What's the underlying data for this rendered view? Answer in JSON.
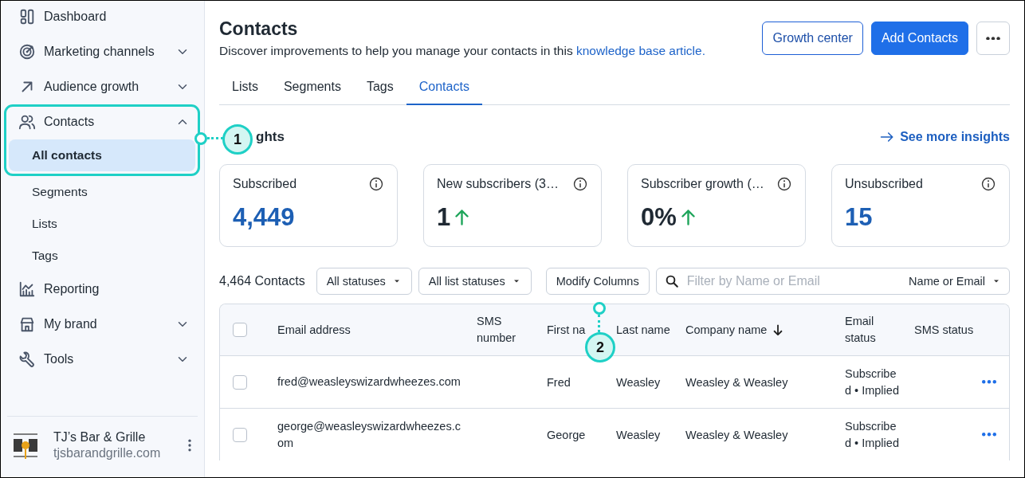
{
  "sidebar": {
    "items": [
      {
        "label": "Dashboard"
      },
      {
        "label": "Marketing channels",
        "expanded": false
      },
      {
        "label": "Audience growth",
        "expanded": false
      },
      {
        "label": "Contacts",
        "expanded": true,
        "highlighted": true,
        "children": [
          {
            "label": "All contacts",
            "selected": true
          },
          {
            "label": "Segments",
            "selected": false
          },
          {
            "label": "Lists",
            "selected": false
          },
          {
            "label": "Tags",
            "selected": false
          }
        ]
      },
      {
        "label": "Reporting"
      },
      {
        "label": "My brand",
        "expanded": false
      },
      {
        "label": "Tools",
        "expanded": false
      }
    ],
    "account": {
      "name": "TJ’s Bar & Grille",
      "domain": "tjsbarandgrille.com"
    }
  },
  "header": {
    "title": "Contacts",
    "description": "Discover improvements to help you manage your contacts in this ",
    "link": "knowledge base article.",
    "buttons": [
      {
        "label": "Growth center",
        "kind": "outline"
      },
      {
        "label": "Add Contacts",
        "kind": "primary"
      },
      {
        "kind": "more"
      }
    ]
  },
  "tabs": [
    {
      "label": "Lists",
      "selected": false
    },
    {
      "label": "Segments",
      "selected": false
    },
    {
      "label": "Tags",
      "selected": false
    },
    {
      "label": "Contacts",
      "selected": true
    }
  ],
  "insights": {
    "title": "ghts",
    "link": "See more insights",
    "cards": [
      {
        "label": "Subscribed",
        "value": "4,449",
        "color": "#1d5fb4",
        "rising": false
      },
      {
        "label": "New subscribers (3…",
        "value": "1",
        "color": "#1f2933",
        "rising": true
      },
      {
        "label": "Subscriber growth (…",
        "value": "0%",
        "color": "#1f2933",
        "rising": true
      },
      {
        "label": "Unsubscribed",
        "value": "15",
        "color": "#1d5fb4",
        "rising": false
      }
    ]
  },
  "filters": {
    "count": "4,464 Contacts",
    "dropdowns": [
      "All statuses",
      "All list statuses"
    ],
    "button": "Modify Columns",
    "search": {
      "placeholder": "Filter by Name or Email",
      "scope": "Name or Email"
    }
  },
  "table": {
    "header_checked": false,
    "columns": [
      {
        "label": "Email address",
        "sorted": false
      },
      {
        "label": "SMS number",
        "sorted": false
      },
      {
        "label": "First na",
        "sorted": false
      },
      {
        "label": "Last name",
        "sorted": false
      },
      {
        "label": "Company name",
        "sorted": true
      },
      {
        "label": "Email status",
        "sorted": false
      },
      {
        "label": "SMS status",
        "sorted": false
      }
    ],
    "rows": [
      {
        "checked": false,
        "email": "fred@weasleyswizardwheezes.com",
        "first_name": "Fred",
        "last_name": "Weasley",
        "company": "Weasley & Weasley",
        "email_status": "Subscribed • Implied"
      },
      {
        "checked": false,
        "email": "george@weasleyswizardwheezes.com",
        "first_name": "George",
        "last_name": "Weasley",
        "company": "Weasley & Weasley",
        "email_status": "Subscribed • Implied"
      }
    ]
  },
  "callouts": [
    {
      "number": "1"
    },
    {
      "number": "2"
    }
  ]
}
